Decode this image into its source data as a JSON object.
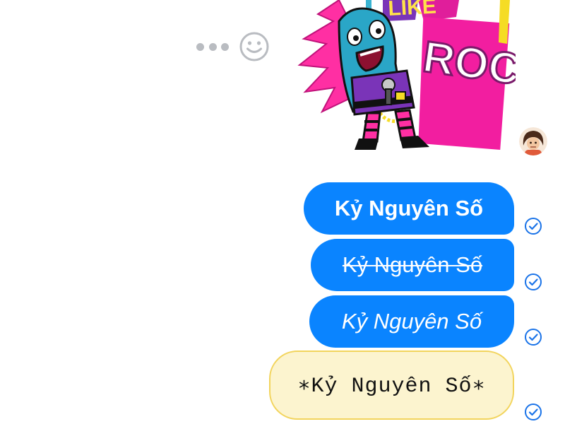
{
  "actions": {
    "more_icon": "more-dots-icon",
    "emoji_icon": "smiley-icon"
  },
  "sticker": {
    "text_top": "LIKE",
    "text_main": "ROCK!",
    "icon": "rock-singer-sticker"
  },
  "avatar": {
    "icon": "user-avatar"
  },
  "messages": [
    {
      "text": "Kỷ Nguyên Số",
      "style": "bold",
      "status": "sent-check-icon"
    },
    {
      "text": "Kỷ Nguyên Số",
      "style": "strikethrough",
      "status": "sent-check-icon"
    },
    {
      "text": "Kỷ Nguyên Số",
      "style": "italic",
      "status": "sent-check-icon"
    },
    {
      "text": "∗Kỷ Nguyên Số∗",
      "style": "monospace",
      "status": "sent-check-icon"
    }
  ],
  "colors": {
    "bubble_blue": "#0a84ff",
    "code_bubble_bg": "#fcf4cf",
    "code_bubble_border": "#f2d45c",
    "check_color": "#1a73e8"
  }
}
